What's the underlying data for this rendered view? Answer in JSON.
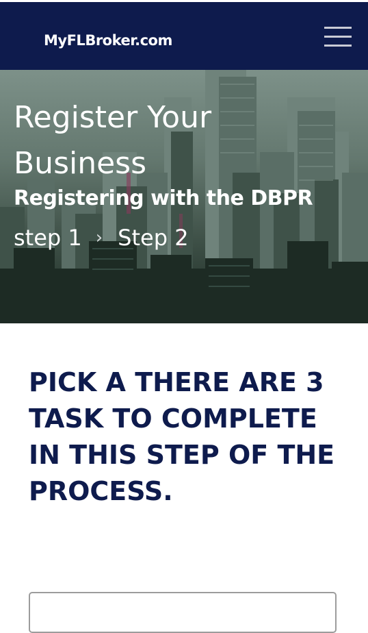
{
  "header": {
    "brand": "MyFLBroker.com",
    "menu_icon": "hamburger-icon",
    "background": "#0e1b4d"
  },
  "hero": {
    "title": "Register Your Business",
    "subtitle": "Registering with the DBPR",
    "breadcrumb": {
      "prev": "step 1",
      "separator": "›",
      "current": "Step 2"
    }
  },
  "content": {
    "heading": "PICK A THERE ARE 3 TASK TO COMPLETE IN THIS STEP OF THE PROCESS.",
    "heading_color": "#0e1b4d"
  },
  "form": {
    "field_value": "",
    "field_placeholder": ""
  }
}
